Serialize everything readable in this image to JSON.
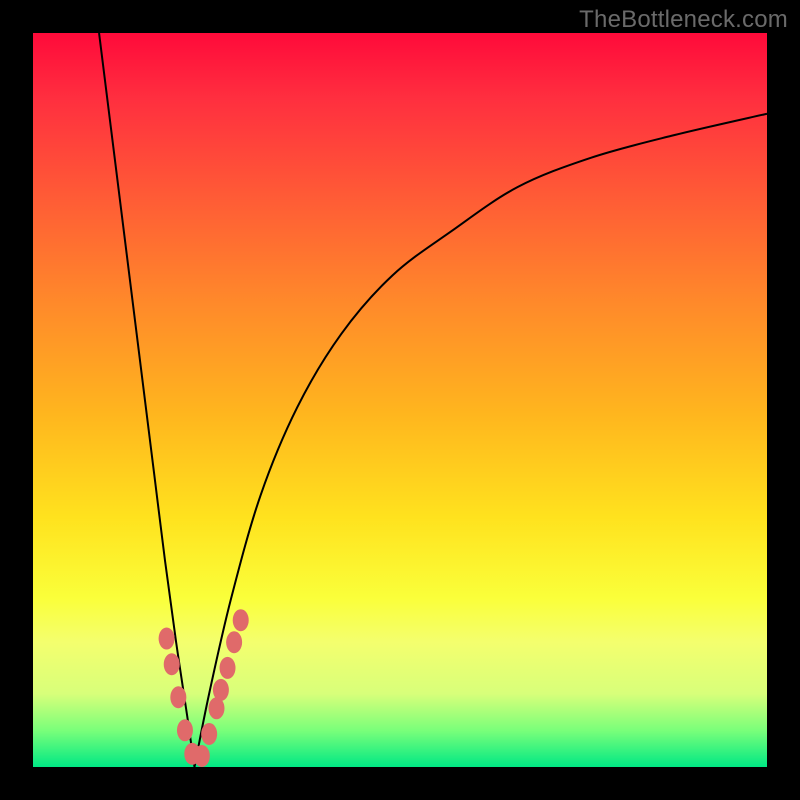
{
  "watermark": "TheBottleneck.com",
  "colors": {
    "frame": "#000000",
    "gradient_top": "#ff0a3a",
    "gradient_mid": "#ffe21e",
    "gradient_bottom": "#00e884",
    "curve": "#000000",
    "bead": "#e06a6a"
  },
  "chart_data": {
    "type": "line",
    "title": "",
    "xlabel": "",
    "ylabel": "",
    "xlim": [
      0,
      100
    ],
    "ylim": [
      0,
      100
    ],
    "note": "Axes are unlabeled; values are pixel-estimated positions normalized to 0–100. Two curves form a V with minimum near x≈22, y≈0. Beads mark points near the bottom of the V.",
    "series": [
      {
        "name": "left-arm",
        "x": [
          9.0,
          10.5,
          12.0,
          13.5,
          15.0,
          16.5,
          18.0,
          19.5,
          21.0,
          22.0
        ],
        "values": [
          100,
          88,
          76,
          64,
          52,
          40,
          28,
          17,
          7,
          0
        ]
      },
      {
        "name": "right-arm",
        "x": [
          22.0,
          24.0,
          27.0,
          31.0,
          36.0,
          42.0,
          49.0,
          57.0,
          66.0,
          76.0,
          87.0,
          100.0
        ],
        "values": [
          0,
          10,
          23,
          37,
          49,
          59,
          67,
          73,
          79,
          83,
          86,
          89
        ]
      }
    ],
    "beads": [
      {
        "x": 18.2,
        "y": 17.5
      },
      {
        "x": 18.9,
        "y": 14.0
      },
      {
        "x": 19.8,
        "y": 9.5
      },
      {
        "x": 20.7,
        "y": 5.0
      },
      {
        "x": 21.7,
        "y": 1.8
      },
      {
        "x": 23.0,
        "y": 1.5
      },
      {
        "x": 24.0,
        "y": 4.5
      },
      {
        "x": 25.0,
        "y": 8.0
      },
      {
        "x": 25.6,
        "y": 10.5
      },
      {
        "x": 26.5,
        "y": 13.5
      },
      {
        "x": 27.4,
        "y": 17.0
      },
      {
        "x": 28.3,
        "y": 20.0
      }
    ]
  }
}
